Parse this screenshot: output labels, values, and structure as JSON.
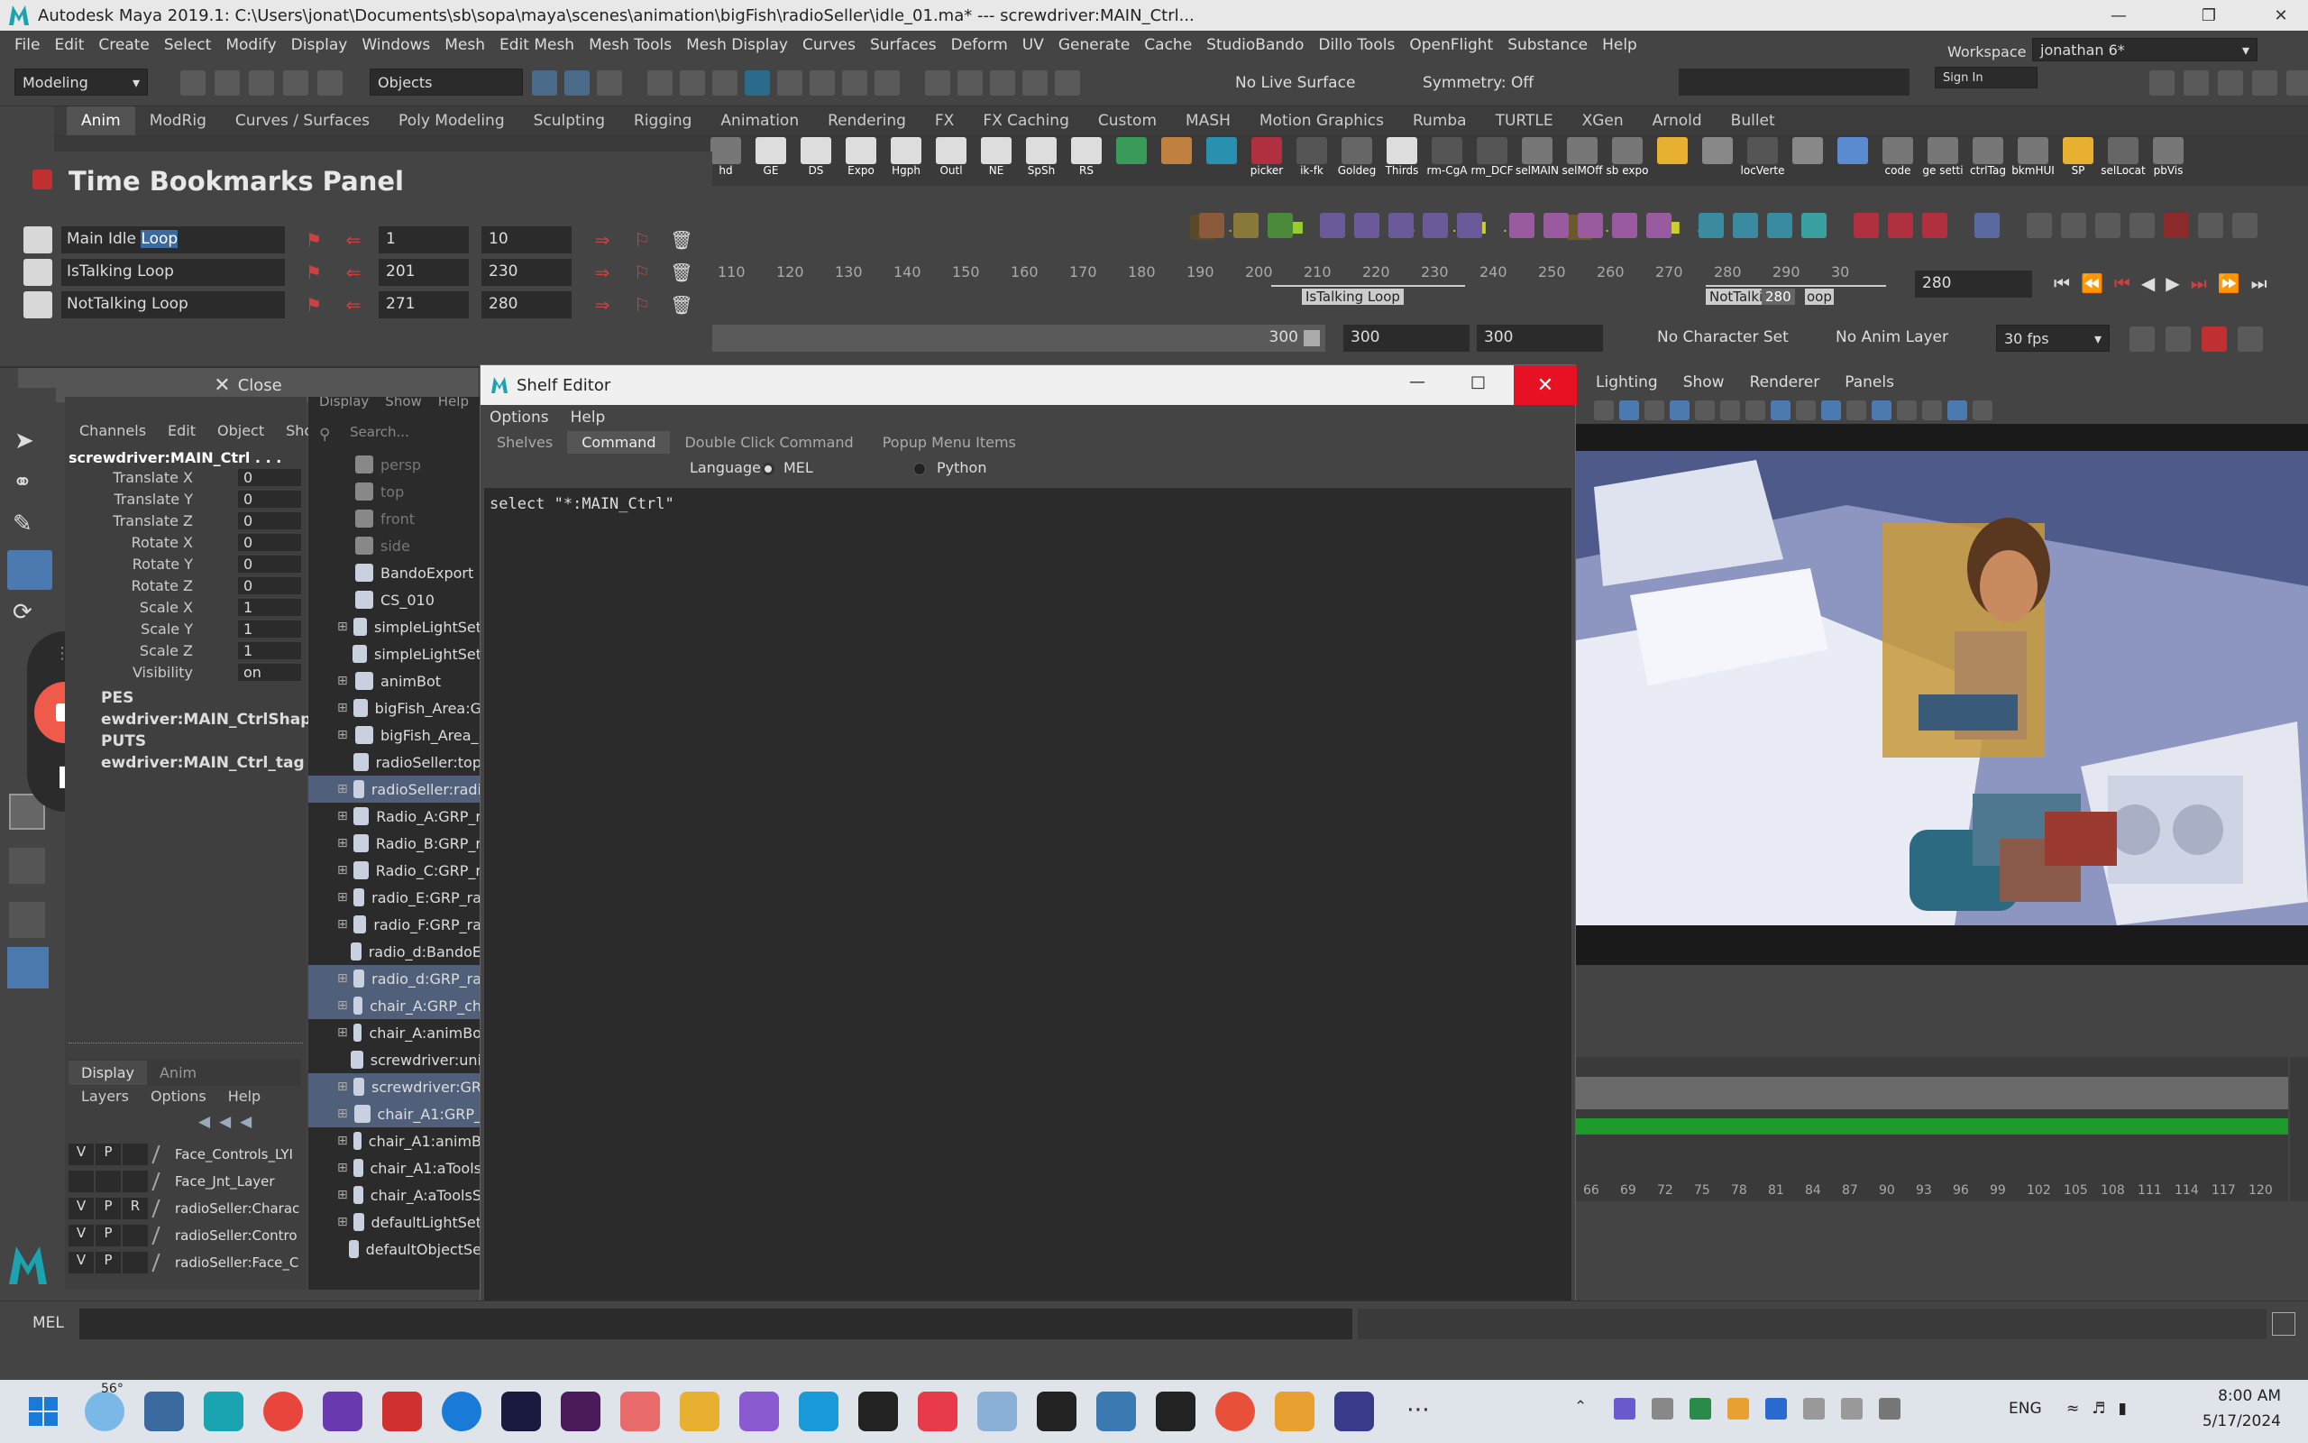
{
  "window": {
    "title": "Autodesk Maya 2019.1: C:\\Users\\jonat\\Documents\\sb\\sopa\\maya\\scenes\\animation\\bigFish\\radioSeller\\idle_01.ma*  ---  screwdriver:MAIN_Ctrl..."
  },
  "menubar": [
    "File",
    "Edit",
    "Create",
    "Select",
    "Modify",
    "Display",
    "Windows",
    "Mesh",
    "Edit Mesh",
    "Mesh Tools",
    "Mesh Display",
    "Curves",
    "Surfaces",
    "Deform",
    "UV",
    "Generate",
    "Cache",
    "StudioBando",
    "Dillo Tools",
    "OpenFlight",
    "Substance",
    "Help"
  ],
  "workspace": {
    "label": "Workspace :",
    "value": "jonathan 6*"
  },
  "statusline": {
    "mode": "Modeling",
    "objects": "Objects",
    "live_surface": "No Live Surface",
    "symmetry": "Symmetry: Off",
    "sign_in": "Sign In"
  },
  "shelf_tabs": [
    "Anim",
    "ModRig",
    "Curves / Surfaces",
    "Poly Modeling",
    "Sculpting",
    "Rigging",
    "Animation",
    "Rendering",
    "FX",
    "FX Caching",
    "Custom",
    "MASH",
    "Motion Graphics",
    "Rumba",
    "TURTLE",
    "XGen",
    "Arnold",
    "Bullet"
  ],
  "shelf_items": [
    "hd",
    "GE",
    "DS",
    "Expo",
    "Hgph",
    "Outl",
    "NE",
    "SpSh",
    "RS",
    "",
    "",
    "",
    "picker",
    "ik-fk",
    "Goldeg",
    "Thirds",
    "rm-CgA",
    "rm_DCF",
    "selMAIN",
    "selMOff",
    "sb expo",
    "",
    "",
    "locVerte",
    "",
    "",
    "code",
    "ge setti",
    "ctrlTag",
    "bkmHUI",
    "SP",
    "selLocat",
    "pbVis"
  ],
  "bookmarks": {
    "title": "Time Bookmarks Panel",
    "rows": [
      {
        "name": "Main Idle ",
        "highlight": "Loop",
        "start": "1",
        "end": "10"
      },
      {
        "name": "IsTalking Loop",
        "highlight": "",
        "start": "201",
        "end": "230"
      },
      {
        "name": "NotTalking Loop",
        "highlight": "",
        "start": "271",
        "end": "280"
      }
    ],
    "close_label": "Close"
  },
  "timeline": {
    "ticks": [
      "110",
      "120",
      "130",
      "140",
      "150",
      "160",
      "170",
      "180",
      "190",
      "200",
      "210",
      "220",
      "230",
      "240",
      "250",
      "260",
      "270",
      "280",
      "290",
      "30"
    ],
    "bookmark_istalking": "IsTalking Loop",
    "bookmark_nottalking": "NotTalki",
    "current_frame_tag": "280",
    "nt_suffix": "oop",
    "current_frame": "280"
  },
  "range": {
    "end_slider": "300",
    "anim_end": "300",
    "playback_end": "300",
    "character_set": "No Character Set",
    "anim_layer": "No Anim Layer",
    "fps": "30 fps"
  },
  "channelbox": {
    "tabs": [
      "Channels",
      "Edit",
      "Object",
      "Show"
    ],
    "node": "screwdriver:MAIN_Ctrl . . .",
    "channels": [
      {
        "label": "Translate X",
        "value": "0"
      },
      {
        "label": "Translate Y",
        "value": "0"
      },
      {
        "label": "Translate Z",
        "value": "0"
      },
      {
        "label": "Rotate X",
        "value": "0"
      },
      {
        "label": "Rotate Y",
        "value": "0"
      },
      {
        "label": "Rotate Z",
        "value": "0"
      },
      {
        "label": "Scale X",
        "value": "1"
      },
      {
        "label": "Scale Y",
        "value": "1"
      },
      {
        "label": "Scale Z",
        "value": "1"
      },
      {
        "label": "Visibility",
        "value": "on"
      }
    ],
    "shapes_header": "PES",
    "shape_node": "ewdriver:MAIN_CtrlShape",
    "inputs_header": "PUTS",
    "input_node": "ewdriver:MAIN_Ctrl_tag",
    "layer_tabs": [
      "Display",
      "Anim"
    ],
    "layer_menu": [
      "Layers",
      "Options",
      "Help"
    ],
    "layers": [
      {
        "v": "V",
        "p": "P",
        "r": "",
        "name": "Face_Controls_LYI"
      },
      {
        "v": "",
        "p": "",
        "r": "",
        "name": "Face_Jnt_Layer"
      },
      {
        "v": "V",
        "p": "P",
        "r": "R",
        "name": "radioSeller:Charac"
      },
      {
        "v": "V",
        "p": "P",
        "r": "",
        "name": "radioSeller:Contro"
      },
      {
        "v": "V",
        "p": "P",
        "r": "",
        "name": "radioSeller:Face_C"
      }
    ]
  },
  "outliner": {
    "menu": [
      "Display",
      "Show",
      "Help"
    ],
    "search_placeholder": "Search...",
    "items": [
      {
        "name": "persp",
        "plus": "",
        "sel": false,
        "dim": true
      },
      {
        "name": "top",
        "plus": "",
        "sel": false,
        "dim": true
      },
      {
        "name": "front",
        "plus": "",
        "sel": false,
        "dim": true
      },
      {
        "name": "side",
        "plus": "",
        "sel": false,
        "dim": true
      },
      {
        "name": "BandoExport",
        "plus": "",
        "sel": false,
        "dim": false
      },
      {
        "name": "CS_010",
        "plus": "",
        "sel": false,
        "dim": false
      },
      {
        "name": "simpleLightSet",
        "plus": "⊞",
        "sel": false,
        "dim": false
      },
      {
        "name": "simpleLightSet",
        "plus": "",
        "sel": false,
        "dim": false
      },
      {
        "name": "animBot",
        "plus": "⊞",
        "sel": false,
        "dim": false
      },
      {
        "name": "bigFish_Area:G",
        "plus": "⊞",
        "sel": false,
        "dim": false
      },
      {
        "name": "bigFish_Area_",
        "plus": "⊞",
        "sel": false,
        "dim": false
      },
      {
        "name": "radioSeller:top",
        "plus": "",
        "sel": false,
        "dim": false
      },
      {
        "name": "radioSeller:radi",
        "plus": "⊞",
        "sel": true,
        "dim": false
      },
      {
        "name": "Radio_A:GRP_r",
        "plus": "⊞",
        "sel": false,
        "dim": false
      },
      {
        "name": "Radio_B:GRP_r",
        "plus": "⊞",
        "sel": false,
        "dim": false
      },
      {
        "name": "Radio_C:GRP_r",
        "plus": "⊞",
        "sel": false,
        "dim": false
      },
      {
        "name": "radio_E:GRP_ra",
        "plus": "⊞",
        "sel": false,
        "dim": false
      },
      {
        "name": "radio_F:GRP_ra",
        "plus": "⊞",
        "sel": false,
        "dim": false
      },
      {
        "name": "radio_d:BandoE",
        "plus": "",
        "sel": false,
        "dim": false
      },
      {
        "name": "radio_d:GRP_ra",
        "plus": "⊞",
        "sel": true,
        "dim": false
      },
      {
        "name": "chair_A:GRP_ch",
        "plus": "⊞",
        "sel": true,
        "dim": false
      },
      {
        "name": "chair_A:animBo",
        "plus": "⊞",
        "sel": false,
        "dim": false
      },
      {
        "name": "screwdriver:uni",
        "plus": "",
        "sel": false,
        "dim": false
      },
      {
        "name": "screwdriver:GR",
        "plus": "⊞",
        "sel": true,
        "dim": false
      },
      {
        "name": "chair_A1:GRP_",
        "plus": "⊞",
        "sel": true,
        "dim": false
      },
      {
        "name": "chair_A1:animB",
        "plus": "⊞",
        "sel": false,
        "dim": false
      },
      {
        "name": "chair_A1:aTools",
        "plus": "⊞",
        "sel": false,
        "dim": false
      },
      {
        "name": "chair_A:aToolsS",
        "plus": "⊞",
        "sel": false,
        "dim": false
      },
      {
        "name": "defaultLightSet",
        "plus": "⊞",
        "sel": false,
        "dim": false
      },
      {
        "name": "defaultObjectSe",
        "plus": "",
        "sel": false,
        "dim": false
      }
    ]
  },
  "shelf_editor": {
    "title": "Shelf Editor",
    "menu": [
      "Options",
      "Help"
    ],
    "tabs": [
      "Shelves",
      "Command",
      "Double Click Command",
      "Popup Menu Items"
    ],
    "language_label": "Language:",
    "lang_mel": "MEL",
    "lang_python": "Python",
    "command": "select \"*:MAIN_Ctrl\""
  },
  "viewport": {
    "menu": [
      "Lighting",
      "Show",
      "Renderer",
      "Panels"
    ]
  },
  "graph": {
    "ticks": [
      "66",
      "69",
      "72",
      "75",
      "78",
      "81",
      "84",
      "87",
      "90",
      "93",
      "96",
      "99",
      "102",
      "105",
      "108",
      "111",
      "114",
      "117",
      "120"
    ]
  },
  "melbar": {
    "label": "MEL"
  },
  "taskbar": {
    "weather": "56°",
    "lang": "ENG",
    "time": "8:00 AM",
    "date": "5/17/2024"
  },
  "colors": {
    "maya_teal": "#1aa3b0",
    "bookmark_red": "#d04040",
    "selection": "#50607a",
    "timeline_green": "#1d9a2a",
    "close_red": "#e81123"
  }
}
